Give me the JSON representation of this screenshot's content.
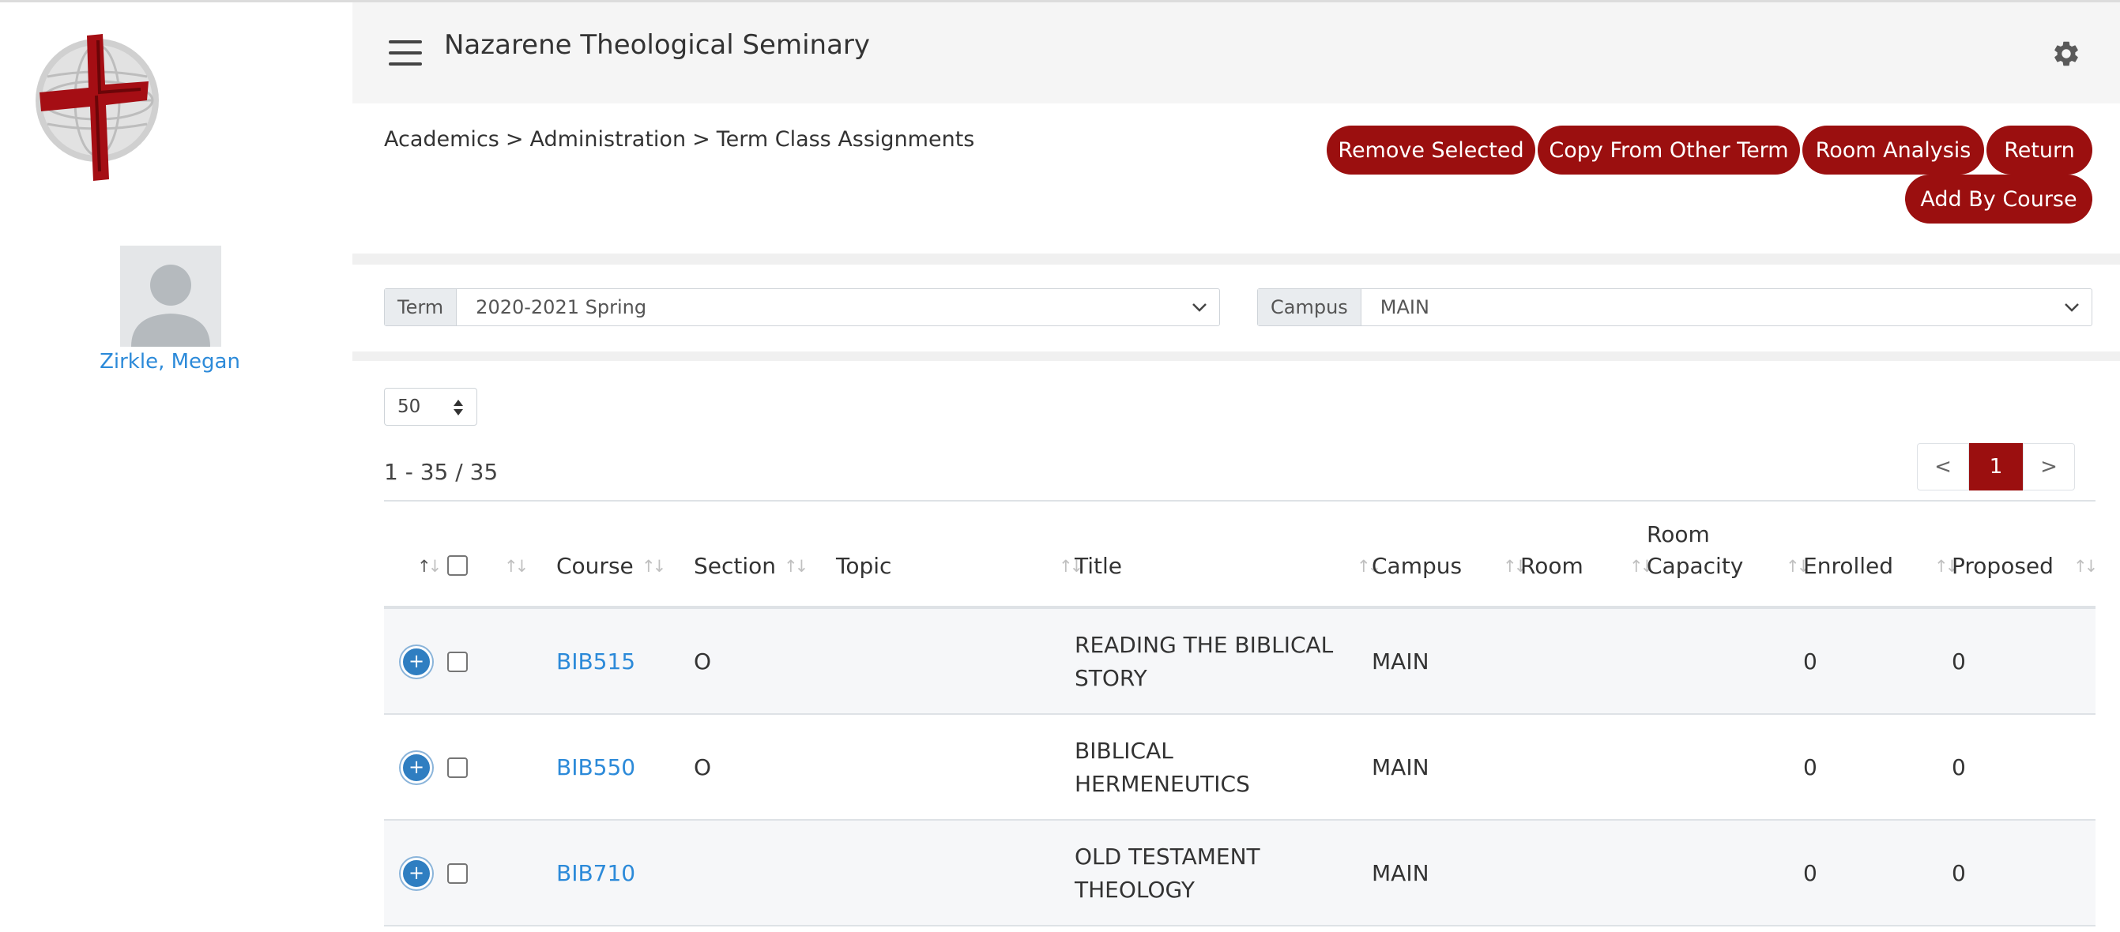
{
  "header": {
    "app_title": "Nazarene Theological Seminary"
  },
  "user": {
    "name": "Zirkle, Megan"
  },
  "breadcrumb": [
    "Academics",
    ">",
    "Administration",
    ">",
    "Term Class Assignments"
  ],
  "actions": {
    "remove_selected": "Remove Selected",
    "copy_from_other_term": "Copy From Other Term",
    "room_analysis": "Room Analysis",
    "return": "Return",
    "add_by_course": "Add By Course"
  },
  "filters": {
    "term_label": "Term",
    "term_value": "2020-2021 Spring",
    "campus_label": "Campus",
    "campus_value": "MAIN"
  },
  "list": {
    "page_size": "50",
    "range": "1 - 35 / 35",
    "pager": {
      "prev": "<",
      "current": "1",
      "next": ">"
    }
  },
  "table": {
    "columns": {
      "course": "Course",
      "section": "Section",
      "topic": "Topic",
      "title": "Title",
      "campus": "Campus",
      "room": "Room",
      "room_capacity_1": "Room",
      "room_capacity_2": "Capacity",
      "enrolled": "Enrolled",
      "proposed": "Proposed"
    },
    "rows": [
      {
        "course": "BIB515",
        "section": "O",
        "topic": "",
        "title_1": "READING THE BIBLICAL",
        "title_2": "STORY",
        "campus": "MAIN",
        "room": "",
        "room_capacity": "",
        "enrolled": "0",
        "proposed": "0"
      },
      {
        "course": "BIB550",
        "section": "O",
        "topic": "",
        "title_1": "BIBLICAL",
        "title_2": "HERMENEUTICS",
        "campus": "MAIN",
        "room": "",
        "room_capacity": "",
        "enrolled": "0",
        "proposed": "0"
      },
      {
        "course": "BIB710",
        "section": "",
        "topic": "",
        "title_1": "OLD TESTAMENT",
        "title_2": "THEOLOGY",
        "campus": "MAIN",
        "room": "",
        "room_capacity": "",
        "enrolled": "0",
        "proposed": "0"
      }
    ]
  },
  "icons": {
    "menu": "hamburger-menu-icon",
    "settings": "gear-icon",
    "expand": "plus-circle-icon",
    "sort": "sort-arrows-icon",
    "logo": "cross-globe-logo"
  },
  "colors": {
    "accent": "#9b0f0f",
    "link": "#2c8ad9",
    "expand": "#2f7ec1"
  }
}
